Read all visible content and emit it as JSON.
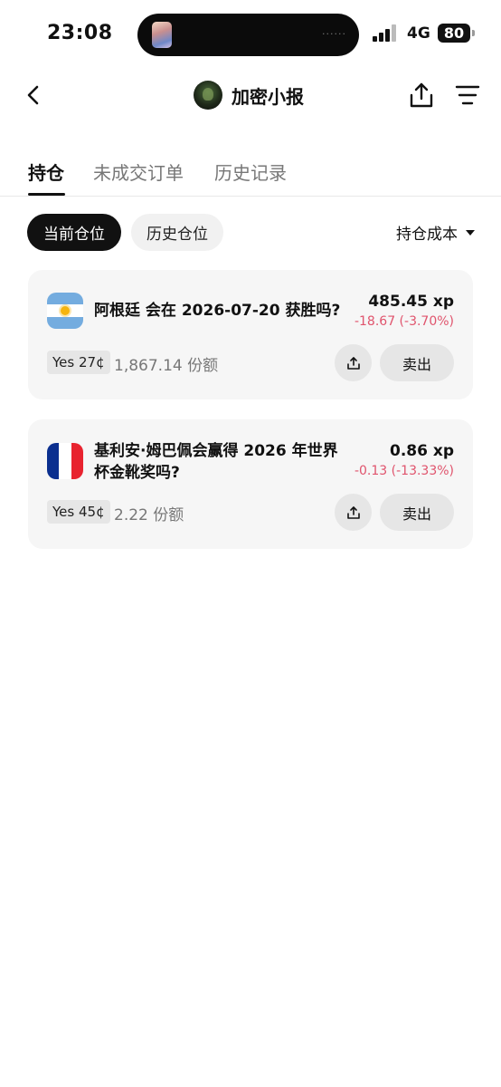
{
  "status_bar": {
    "time": "23:08",
    "island_dots": "......",
    "network": "4G",
    "battery": "80"
  },
  "header": {
    "title": "加密小报"
  },
  "tabs": [
    {
      "label": "持仓",
      "active": true
    },
    {
      "label": "未成交订单",
      "active": false
    },
    {
      "label": "历史记录",
      "active": false
    }
  ],
  "filters": {
    "current_label": "当前仓位",
    "history_label": "历史仓位",
    "sort_label": "持仓成本"
  },
  "positions": [
    {
      "flag": "argentina-flag-icon",
      "title": "阿根廷 会在 2026-07-20 获胜吗?",
      "value": "485.45 xp",
      "change": "-18.67 (-3.70%)",
      "outcome": "Yes 27¢",
      "shares": "1,867.14 份额",
      "sell_label": "卖出"
    },
    {
      "flag": "france-flag-icon",
      "title_line1": "基利安·姆巴佩会赢得 2026 年世界",
      "title_line2": "杯金靴奖吗?",
      "value": "0.86 xp",
      "change": "-0.13 (-13.33%)",
      "outcome": "Yes 45¢",
      "shares": "2.22 份额",
      "sell_label": "卖出"
    }
  ],
  "colors": {
    "negative": "#e0546d",
    "active": "#111111",
    "card_bg": "#f6f6f6",
    "france_blue": "#0b2f8f",
    "france_red": "#e8232f",
    "argentina_blue": "#74acdf"
  }
}
